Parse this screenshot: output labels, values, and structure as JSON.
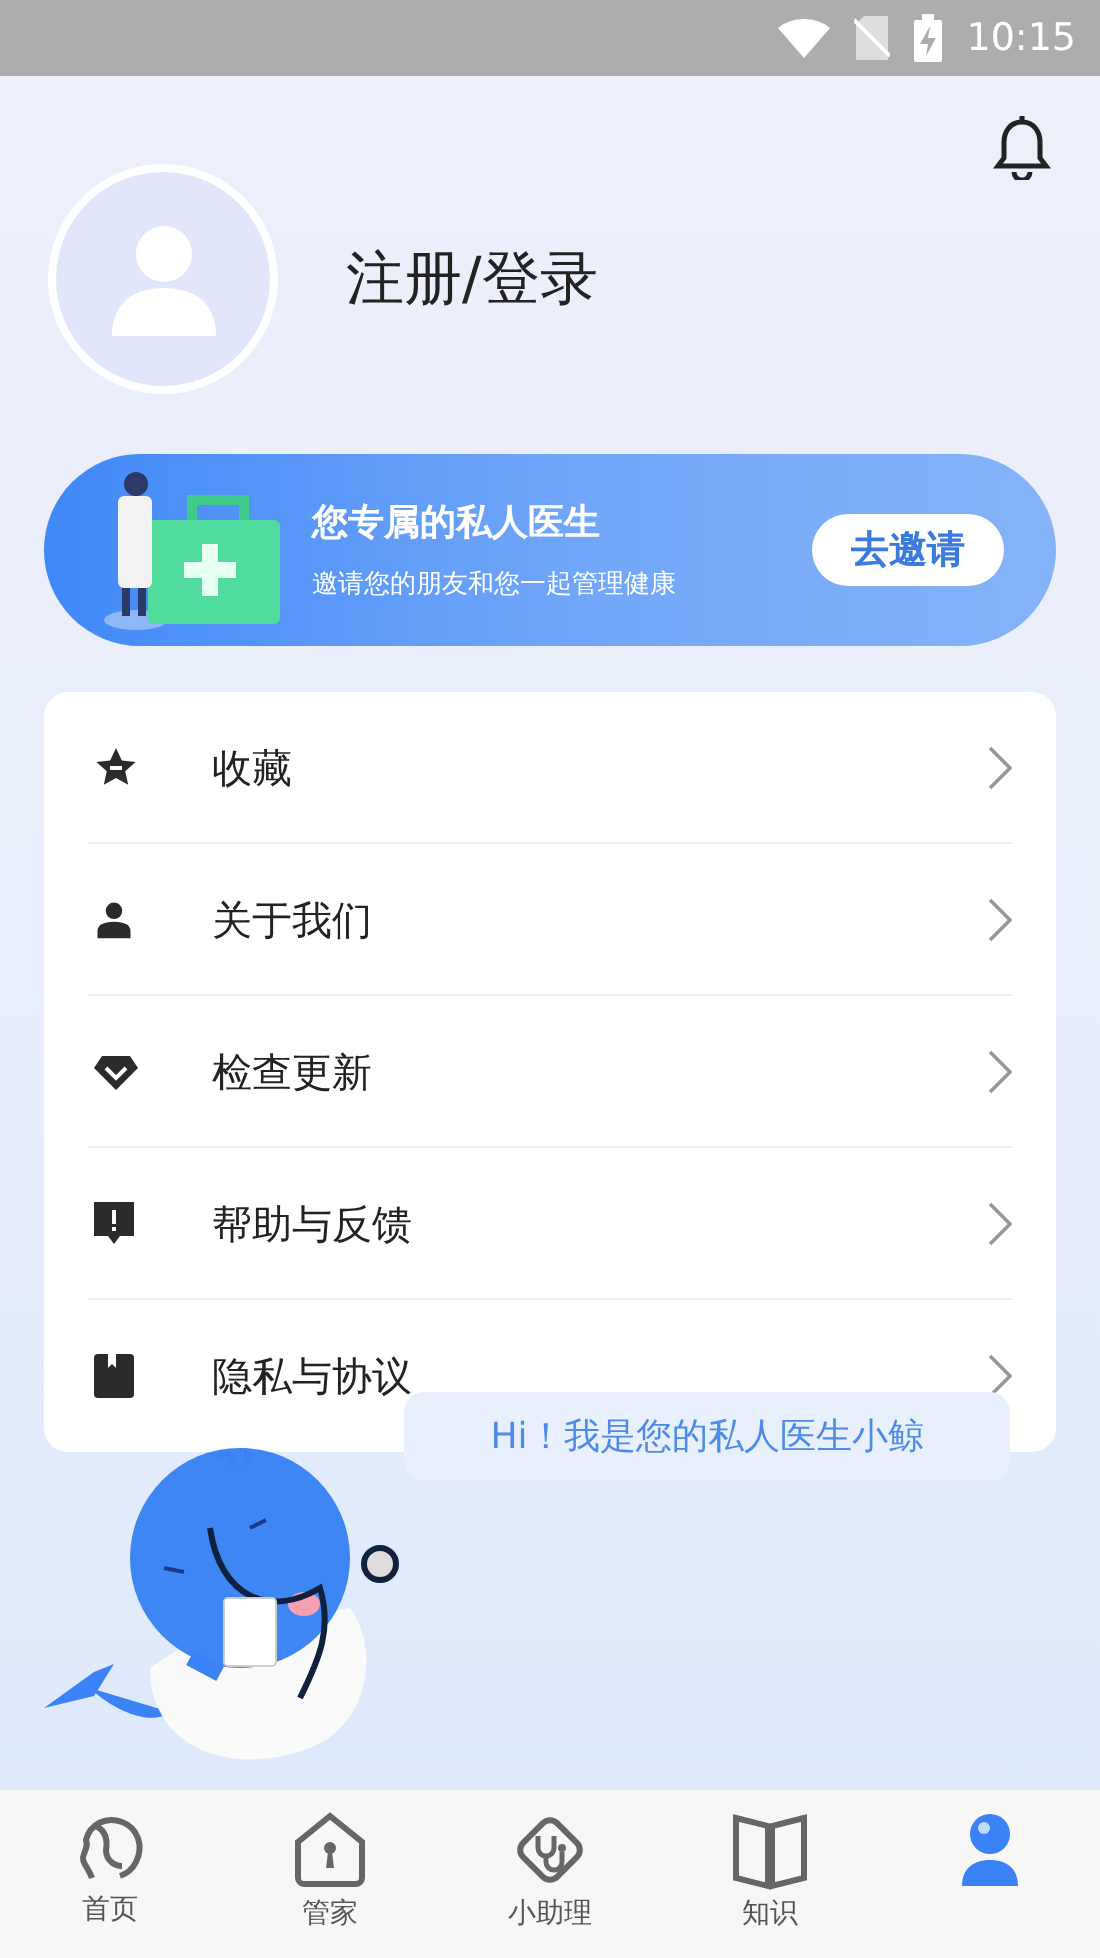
{
  "status_bar": {
    "time": "10:15"
  },
  "profile": {
    "login_label": "注册/登录"
  },
  "banner": {
    "title": "您专属的私人医生",
    "subtitle": "邀请您的朋友和您一起管理健康",
    "button": "去邀请"
  },
  "menu": [
    {
      "kind": "star",
      "label": "收藏"
    },
    {
      "kind": "person",
      "label": "关于我们"
    },
    {
      "kind": "diamond",
      "label": "检查更新"
    },
    {
      "kind": "alert",
      "label": "帮助与反馈"
    },
    {
      "kind": "book",
      "label": "隐私与协议"
    }
  ],
  "assistant": {
    "bubble": "Hi！我是您的私人医生小鲸"
  },
  "tabs": [
    {
      "kind": "home",
      "label": "首页",
      "selected": false
    },
    {
      "kind": "house",
      "label": "管家",
      "selected": false
    },
    {
      "kind": "stethoscope",
      "label": "小助理",
      "selected": false
    },
    {
      "kind": "book",
      "label": "知识",
      "selected": false
    },
    {
      "kind": "profile",
      "selected": true
    }
  ]
}
